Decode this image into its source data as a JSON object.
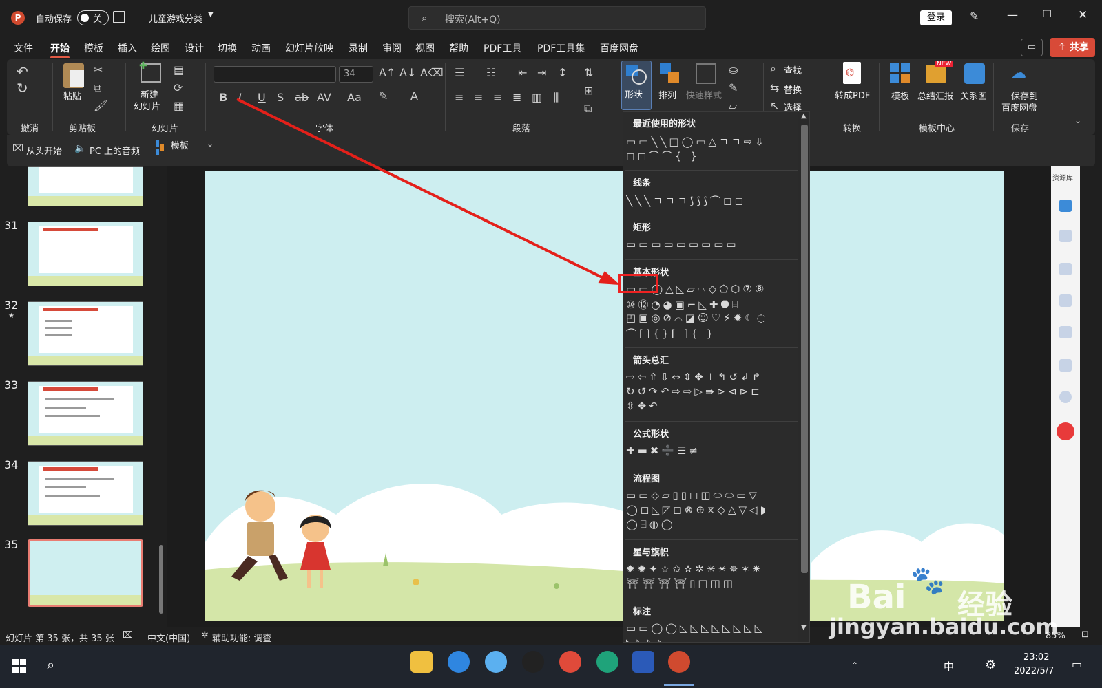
{
  "titlebar": {
    "autosave_label": "自动保存",
    "autosave_state": "关",
    "doc_title": "儿童游戏分类",
    "search_placeholder": "搜索(Alt+Q)",
    "login": "登录"
  },
  "menu": [
    "文件",
    "开始",
    "模板",
    "插入",
    "绘图",
    "设计",
    "切换",
    "动画",
    "幻灯片放映",
    "录制",
    "审阅",
    "视图",
    "帮助",
    "PDF工具",
    "PDF工具集",
    "百度网盘"
  ],
  "menu_active": "开始",
  "share_label": "共享",
  "ribbon": {
    "undo_group": "撤消",
    "clipboard_group": "剪贴板",
    "paste": "粘贴",
    "slides_group": "幻灯片",
    "new_slide_1": "新建",
    "new_slide_2": "幻灯片",
    "font_group": "字体",
    "font_size": "34",
    "paragraph_group": "段落",
    "shapes": "形状",
    "arrange": "排列",
    "quick_styles": "快速样式",
    "find": "查找",
    "replace": "替换",
    "select": "选择",
    "convert_pdf": "转成PDF",
    "convert_group": "转换",
    "template": "模板",
    "summary": "总结汇报",
    "relation": "关系图",
    "template_center": "模板中心",
    "new_badge": "NEW",
    "save_baidu_1": "保存到",
    "save_baidu_2": "百度网盘",
    "save_group": "保存"
  },
  "quickbar": {
    "from_start": "从头开始",
    "pc_audio": "PC 上的音频",
    "template": "模板"
  },
  "thumbnails": [
    "31",
    "32",
    "33",
    "34",
    "35"
  ],
  "rightpane": {
    "resources": "资源库"
  },
  "statusbar": {
    "slide_info": "幻灯片 第 35 张，共 35 张",
    "language": "中文(中国)",
    "accessibility": "辅助功能: 调查",
    "zoom": "85%"
  },
  "taskbar": {
    "time": "23:02",
    "date": "2022/5/7",
    "ime": "中"
  },
  "shapes_menu": {
    "sections": [
      {
        "title": "最近使用的形状",
        "rows": [
          "▭▭╲╲□◯▭△ㄱㄱ⇨⇩",
          "◻◻⌒⌒{ }"
        ]
      },
      {
        "title": "线条",
        "rows": [
          "╲╲╲ㄱㄱㄱ⟆⟆⟆⌒◻◻"
        ]
      },
      {
        "title": "矩形",
        "rows": [
          "▭▭▭▭▭▭▭▭▭"
        ]
      },
      {
        "title": "基本形状",
        "rows": [
          "▭▭◯△◺▱⏢◇⬠⬡⑦⑧",
          "⑩⑫◔◕▣⌐◺✚⯃⌸",
          "◰▣◎⊘⌓◪☺♡⚡✹☾◌",
          "⌒[]{}[ ]{ }"
        ]
      },
      {
        "title": "箭头总汇",
        "rows": [
          "⇨⇦⇧⇩⇔⇕✥⊥↰↺↲↱",
          "↻↺↷↶⇨⇨▷⇛⊳⊲⊳⊏",
          "⇳✥↶"
        ]
      },
      {
        "title": "公式形状",
        "rows": [
          "✚▬✖➗☰≠"
        ]
      },
      {
        "title": "流程图",
        "rows": [
          "▭▭◇▱▯▯◻◫⬭⬭▭▽",
          "◯◻◺◸◻⊗⊕⧖◇△▽◁◗",
          "◯⌸◍◯"
        ]
      },
      {
        "title": "星与旗帜",
        "rows": [
          "✹✹✦☆✩✫✲✳✴✵✶✷",
          "⛩⛩⛩⛩▯◫◫◫"
        ]
      },
      {
        "title": "标注",
        "rows": [
          "▭▭◯◯◺◺◺◺◺◺◺◺",
          "◺◺◺◺"
        ]
      }
    ]
  },
  "watermark": {
    "brand": "Bai",
    "brand_cn": "经验",
    "url": "jingyan.baidu.com"
  }
}
